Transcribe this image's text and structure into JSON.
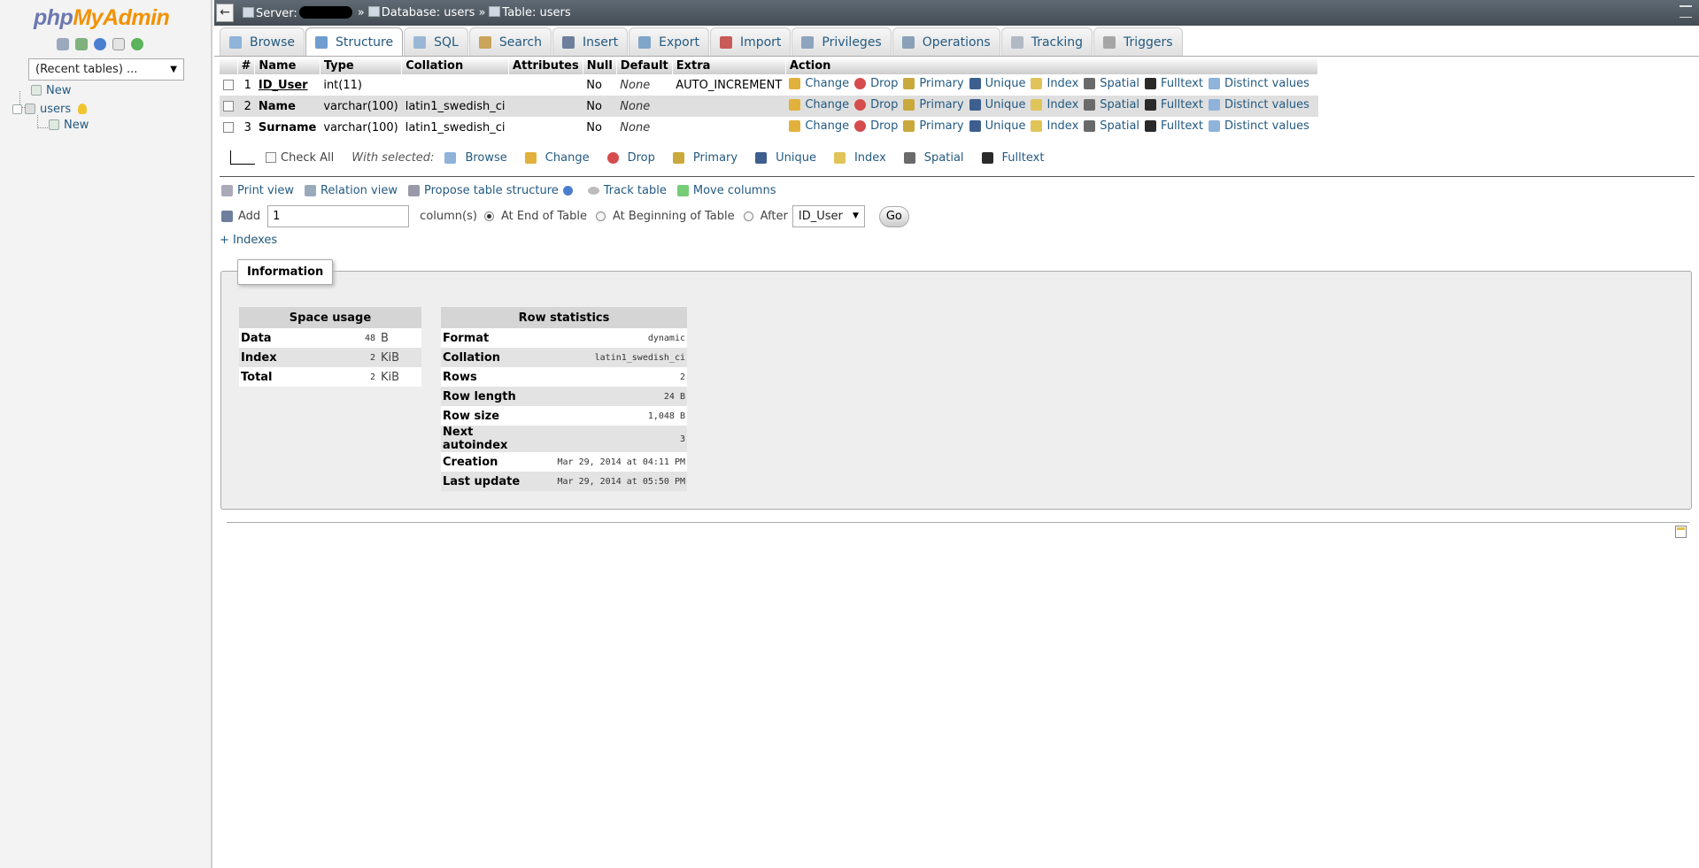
{
  "logo": {
    "php": "php",
    "myadmin": "MyAdmin"
  },
  "nav": {
    "recent_select": "(Recent tables) ...",
    "tree_new": "New",
    "db_name": "users",
    "table_new": "New"
  },
  "topbar": {
    "server_label": "Server:",
    "db_label": "Database: users",
    "table_label": "Table: users",
    "sep": "»"
  },
  "tabs": [
    {
      "label": "Browse",
      "color": "#8fb3d9"
    },
    {
      "label": "Structure",
      "color": "#6f9dcf"
    },
    {
      "label": "SQL",
      "color": "#9ab7d6"
    },
    {
      "label": "Search",
      "color": "#c9a45a"
    },
    {
      "label": "Insert",
      "color": "#6d7f9c"
    },
    {
      "label": "Export",
      "color": "#7fa6c9"
    },
    {
      "label": "Import",
      "color": "#c95a5a"
    },
    {
      "label": "Privileges",
      "color": "#8ea4bf"
    },
    {
      "label": "Operations",
      "color": "#8aa0b8"
    },
    {
      "label": "Tracking",
      "color": "#b0b9c4"
    },
    {
      "label": "Triggers",
      "color": "#a5a5a5"
    }
  ],
  "structure": {
    "headers": [
      "#",
      "Name",
      "Type",
      "Collation",
      "Attributes",
      "Null",
      "Default",
      "Extra",
      "Action"
    ],
    "rows": [
      {
        "num": "1",
        "name": "ID_User",
        "type": "int(11)",
        "collation": "",
        "attributes": "",
        "null": "No",
        "default": "None",
        "extra": "AUTO_INCREMENT"
      },
      {
        "num": "2",
        "name": "Name",
        "type": "varchar(100)",
        "collation": "latin1_swedish_ci",
        "attributes": "",
        "null": "No",
        "default": "None",
        "extra": ""
      },
      {
        "num": "3",
        "name": "Surname",
        "type": "varchar(100)",
        "collation": "latin1_swedish_ci",
        "attributes": "",
        "null": "No",
        "default": "None",
        "extra": ""
      }
    ],
    "actions": [
      "Change",
      "Drop",
      "Primary",
      "Unique",
      "Index",
      "Spatial",
      "Fulltext",
      "Distinct values"
    ]
  },
  "with_selected": {
    "check_all": "Check All",
    "label": "With selected:",
    "buttons": [
      "Browse",
      "Change",
      "Drop",
      "Primary",
      "Unique",
      "Index",
      "Spatial",
      "Fulltext"
    ]
  },
  "links": {
    "print_view": "Print view",
    "relation_view": "Relation view",
    "propose": "Propose table structure",
    "track": "Track table",
    "move": "Move columns"
  },
  "add_columns": {
    "add": "Add",
    "count": "1",
    "columns": "column(s)",
    "at_end": "At End of Table",
    "at_beginning": "At Beginning of Table",
    "after": "After",
    "after_field": "ID_User",
    "go": "Go"
  },
  "indexes_link": "+ Indexes",
  "information": {
    "legend": "Information",
    "space_usage": {
      "title": "Space usage",
      "rows": [
        {
          "label": "Data",
          "value": "48",
          "unit": "B"
        },
        {
          "label": "Index",
          "value": "2",
          "unit": "KiB"
        },
        {
          "label": "Total",
          "value": "2",
          "unit": "KiB"
        }
      ]
    },
    "row_statistics": {
      "title": "Row statistics",
      "rows": [
        {
          "label": "Format",
          "value": "dynamic"
        },
        {
          "label": "Collation",
          "value": "latin1_swedish_ci"
        },
        {
          "label": "Rows",
          "value": "2"
        },
        {
          "label": "Row length",
          "value": "24 B"
        },
        {
          "label": "Row size",
          "value": "1,048 B"
        },
        {
          "label": "Next autoindex",
          "value": "3"
        },
        {
          "label": "Creation",
          "value": "Mar 29, 2014 at 04:11 PM"
        },
        {
          "label": "Last update",
          "value": "Mar 29, 2014 at 05:50 PM"
        }
      ]
    }
  }
}
